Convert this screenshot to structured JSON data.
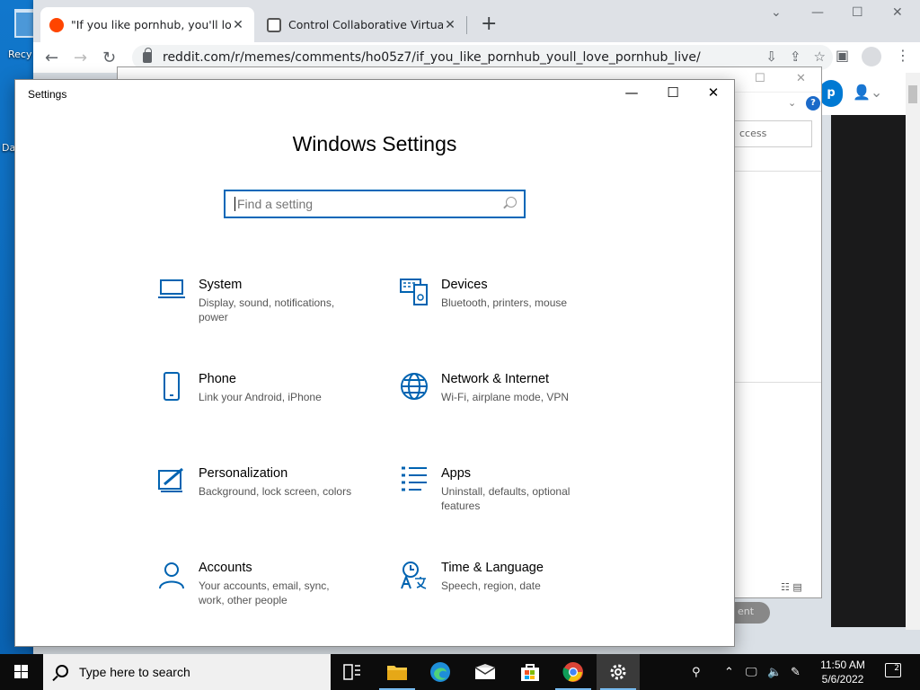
{
  "desktop": {
    "recycle_label": "Recy",
    "other_label": "Da"
  },
  "browser": {
    "tabs": [
      {
        "title": "\"If you like pornhub, you'll love p",
        "close": "✕"
      },
      {
        "title": "Control Collaborative Virtual Ma",
        "close": "✕"
      }
    ],
    "new_tab": "+",
    "url": "reddit.com/r/memes/comments/ho05z7/if_you_like_pornhub_youll_love_pornhub_live/"
  },
  "explorer": {
    "search_placeholder": "ccess",
    "help": "?",
    "grey_button": "ent"
  },
  "reddit": {
    "button_label": "p"
  },
  "settings": {
    "window_title": "Settings",
    "heading": "Windows Settings",
    "search_placeholder": "Find a setting",
    "tiles": [
      {
        "name": "System",
        "desc": "Display, sound, notifications, power"
      },
      {
        "name": "Devices",
        "desc": "Bluetooth, printers, mouse"
      },
      {
        "name": "Phone",
        "desc": "Link your Android, iPhone"
      },
      {
        "name": "Network & Internet",
        "desc": "Wi-Fi, airplane mode, VPN"
      },
      {
        "name": "Personalization",
        "desc": "Background, lock screen, colors"
      },
      {
        "name": "Apps",
        "desc": "Uninstall, defaults, optional features"
      },
      {
        "name": "Accounts",
        "desc": "Your accounts, email, sync, work, other people"
      },
      {
        "name": "Time & Language",
        "desc": "Speech, region, date"
      }
    ]
  },
  "taskbar": {
    "search_placeholder": "Type here to search",
    "time": "11:50 AM",
    "date": "5/6/2022",
    "notification_count": "2"
  },
  "colors": {
    "accent": "#0067b8",
    "icon_blue": "#0063b1",
    "taskbar": "#0c0c0c"
  }
}
